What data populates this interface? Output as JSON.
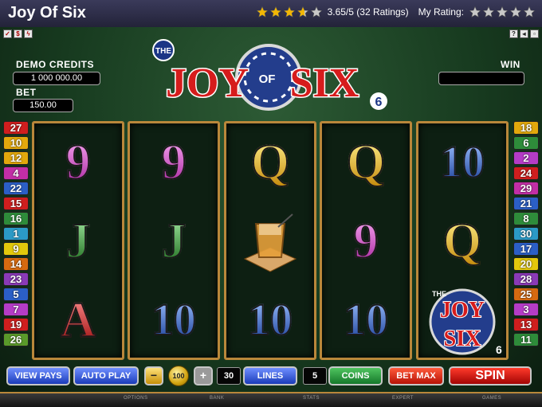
{
  "header": {
    "title": "Joy Of Six",
    "rating_text": "3.65/5 (32 Ratings)",
    "my_rating_label": "My Rating:",
    "avg_rating": 3.65,
    "avg_star_fill": [
      1,
      1,
      1,
      0.65,
      0
    ],
    "my_star_fill": [
      0,
      0,
      0,
      0,
      0
    ],
    "star_color": "#f2b705"
  },
  "game": {
    "logo": {
      "the": "THE",
      "joy": "JOY",
      "of": "OF",
      "six": "SIX",
      "six_badge": "6"
    },
    "demo_credits_label": "DEMO CREDITS",
    "demo_credits_value": "1 000 000.00",
    "bet_label": "BET",
    "bet_value": "150.00",
    "win_label": "WIN",
    "win_value": "",
    "paylines_left": [
      {
        "n": "27",
        "color": "#d01e1e"
      },
      {
        "n": "10",
        "color": "#e2a80c"
      },
      {
        "n": "12",
        "color": "#e2a80c"
      },
      {
        "n": "4",
        "color": "#c22ea6"
      },
      {
        "n": "22",
        "color": "#2b5fc6"
      },
      {
        "n": "15",
        "color": "#d01e1e"
      },
      {
        "n": "16",
        "color": "#2e8c3a"
      },
      {
        "n": "1",
        "color": "#2b9ac6"
      },
      {
        "n": "9",
        "color": "#e2c80c"
      },
      {
        "n": "14",
        "color": "#d66a10"
      },
      {
        "n": "23",
        "color": "#8a3ab7"
      },
      {
        "n": "5",
        "color": "#2b5fc6"
      },
      {
        "n": "7",
        "color": "#b43cc6"
      },
      {
        "n": "19",
        "color": "#d01e1e"
      },
      {
        "n": "26",
        "color": "#5a9a2a"
      }
    ],
    "paylines_right": [
      {
        "n": "18",
        "color": "#e2a80c"
      },
      {
        "n": "6",
        "color": "#2e8c3a"
      },
      {
        "n": "2",
        "color": "#b43cc6"
      },
      {
        "n": "24",
        "color": "#d01e1e"
      },
      {
        "n": "29",
        "color": "#c22ea6"
      },
      {
        "n": "21",
        "color": "#2b5fc6"
      },
      {
        "n": "8",
        "color": "#2e8c3a"
      },
      {
        "n": "30",
        "color": "#2b9ac6"
      },
      {
        "n": "17",
        "color": "#2b5fc6"
      },
      {
        "n": "20",
        "color": "#e2c80c"
      },
      {
        "n": "28",
        "color": "#8a3ab7"
      },
      {
        "n": "25",
        "color": "#d66a10"
      },
      {
        "n": "3",
        "color": "#b43cc6"
      },
      {
        "n": "13",
        "color": "#d01e1e"
      },
      {
        "n": "11",
        "color": "#2e8c3a"
      }
    ],
    "reels": [
      [
        "9",
        "J",
        "A"
      ],
      [
        "9",
        "J",
        "10"
      ],
      [
        "Q",
        "glass-icon",
        "10"
      ],
      [
        "Q",
        "9",
        "10"
      ],
      [
        "10",
        "Q",
        "logo-icon"
      ]
    ]
  },
  "controls": {
    "view_pays": "VIEW PAYS",
    "auto_play": "AUTO PLAY",
    "coin_value": "100",
    "lines_value": "30",
    "lines_label": "LINES",
    "coins_value": "5",
    "coins_label": "COINS",
    "bet_max": "BET MAX",
    "spin": "SPIN"
  },
  "footer": {
    "items": [
      "OPTIONS",
      "BANK",
      "STATS",
      "EXPERT",
      "GAMES"
    ]
  }
}
